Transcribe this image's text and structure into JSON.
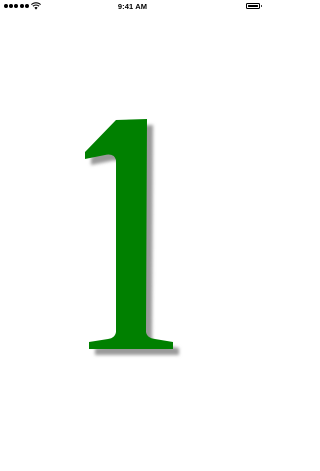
{
  "status_bar": {
    "time": "9:41 AM",
    "signal_dots": 5,
    "wifi_icon": "wifi-icon",
    "battery_icon": "battery-icon",
    "battery_level": 1.0
  },
  "content": {
    "numeral": "1",
    "numeral_color": "#008000",
    "shadow_color": "#9a9a9a"
  }
}
